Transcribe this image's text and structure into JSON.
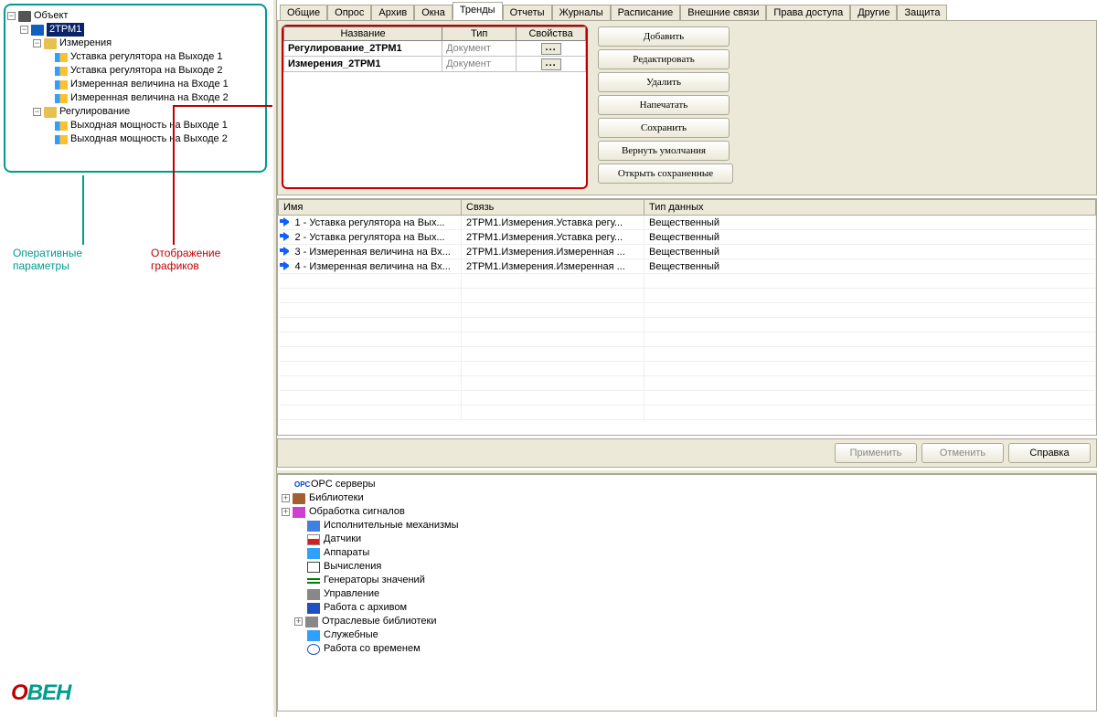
{
  "tree": {
    "root": "Объект",
    "device": "2ТРМ1",
    "g_meas": "Измерения",
    "m1": "Уставка регулятора на Выходе 1",
    "m2": "Уставка регулятора на Выходе 2",
    "m3": "Измеренная величина на Входе 1",
    "m4": "Измеренная величина на Входе 2",
    "g_reg": "Регулирование",
    "r1": "Выходная мощность на Выходе 1",
    "r2": "Выходная мощность на Выходе 2"
  },
  "annot": {
    "params": "Оперативные\nпараметры",
    "charts": "Отображение\nграфиков"
  },
  "tabs": [
    "Общие",
    "Опрос",
    "Архив",
    "Окна",
    "Тренды",
    "Отчеты",
    "Журналы",
    "Расписание",
    "Внешние связи",
    "Права доступа",
    "Другие",
    "Защита"
  ],
  "tgrid": {
    "hName": "Название",
    "hType": "Тип",
    "hProp": "Свойства",
    "r1n": "Регулирование_2ТРМ1",
    "r1t": "Документ",
    "r2n": "Измерения_2ТРМ1",
    "r2t": "Документ"
  },
  "act": {
    "add": "Добавить",
    "edit": "Редактировать",
    "del": "Удалить",
    "print": "Напечатать",
    "save": "Сохранить",
    "defaults": "Вернуть умолчания",
    "open": "Открыть сохраненные"
  },
  "dgrid": {
    "hName": "Имя",
    "hLink": "Связь",
    "hType": "Тип данных",
    "rows": [
      {
        "n": "1 - Уставка регулятора на Вых...",
        "l": "2ТРМ1.Измерения.Уставка регу...",
        "t": "Вещественный"
      },
      {
        "n": "2 - Уставка регулятора на Вых...",
        "l": "2ТРМ1.Измерения.Уставка регу...",
        "t": "Вещественный"
      },
      {
        "n": "3 - Измеренная величина на Вх...",
        "l": "2ТРМ1.Измерения.Измеренная ...",
        "t": "Вещественный"
      },
      {
        "n": "4 - Измеренная величина на Вх...",
        "l": "2ТРМ1.Измерения.Измеренная ...",
        "t": "Вещественный"
      }
    ]
  },
  "footer": {
    "apply": "Применить",
    "cancel": "Отменить",
    "help": "Справка"
  },
  "lib": {
    "opc": "OPC серверы",
    "books": "Библиотеки",
    "sig": "Обработка сигналов",
    "mech": "Исполнительные механизмы",
    "sens": "Датчики",
    "app": "Аппараты",
    "calc": "Вычисления",
    "gen": "Генераторы значений",
    "ctrl": "Управление",
    "arch": "Работа с архивом",
    "ind": "Отраслевые библиотеки",
    "serv": "Служебные",
    "clock": "Работа со временем"
  },
  "logo": "ВЕН"
}
